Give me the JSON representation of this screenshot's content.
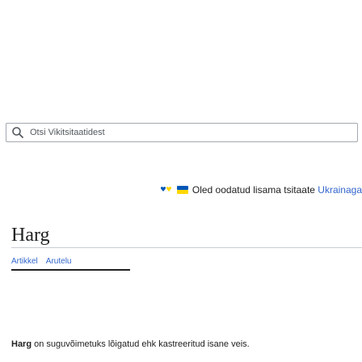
{
  "search": {
    "placeholder": "Otsi Vikitsitaatidest",
    "icon": "search-icon"
  },
  "banner": {
    "prefix": "Oled oodatud lisama tsitaate ",
    "link": "Ukrainaga",
    "icons": [
      "flag-heart-icon",
      "help-hands-icon"
    ],
    "colors": {
      "link": "#3366cc",
      "blue": "#0057b7",
      "yellow": "#ffd700"
    }
  },
  "page": {
    "title": "Harg"
  },
  "tabs": [
    {
      "label": "Artikkel",
      "active": true
    },
    {
      "label": "Arutelu",
      "active": false
    }
  ],
  "lead": {
    "term": "Harg",
    "rest": " on suguvõimetuks lõigatud ehk kastreeritud isane veis."
  }
}
